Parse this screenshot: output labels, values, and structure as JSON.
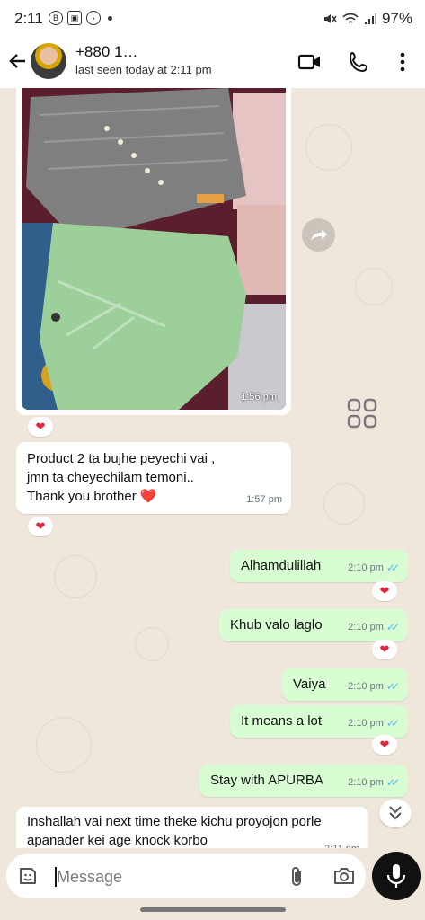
{
  "status_bar": {
    "time": "2:11",
    "battery": "97%",
    "icons": [
      "b-circle-icon",
      "image-icon",
      "chevron-circle-icon",
      "mute-icon",
      "wifi-icon",
      "signal-icon"
    ]
  },
  "header": {
    "contact_name": "+880 1…",
    "last_seen": "last seen today at 2:11 pm"
  },
  "messages": [
    {
      "type": "image",
      "direction": "in",
      "time": "1:56 pm",
      "reaction": "❤"
    },
    {
      "type": "text",
      "direction": "in",
      "lines": [
        "Product 2 ta bujhe peyechi vai ,",
        "jmn ta cheyechilam temoni..",
        "Thank you brother ❤️"
      ],
      "time": "1:57 pm",
      "reaction": "❤"
    },
    {
      "type": "text",
      "direction": "out",
      "text": "Alhamdulillah",
      "time": "2:10 pm",
      "status": "read",
      "reaction": "❤"
    },
    {
      "type": "text",
      "direction": "out",
      "text": "Khub valo laglo",
      "time": "2:10 pm",
      "status": "read",
      "reaction": "❤"
    },
    {
      "type": "text",
      "direction": "out",
      "text": "Vaiya",
      "time": "2:10 pm",
      "status": "read"
    },
    {
      "type": "text",
      "direction": "out",
      "text": "It means a lot",
      "time": "2:10 pm",
      "status": "read",
      "reaction": "❤"
    },
    {
      "type": "text",
      "direction": "out",
      "text": "Stay with APURBA",
      "time": "2:10 pm",
      "status": "read"
    },
    {
      "type": "text",
      "direction": "in",
      "lines": [
        "Inshallah vai next time theke kichu proyojon porle",
        "apanader kei age knock korbo"
      ],
      "time": "2:11 pm"
    }
  ],
  "input": {
    "placeholder": "Message"
  },
  "colors": {
    "outgoing_bubble": "#d9fdd3",
    "incoming_bubble": "#ffffff",
    "read_ticks": "#53bdeb",
    "chat_background": "#efe7dc",
    "heart": "#e2243b"
  }
}
